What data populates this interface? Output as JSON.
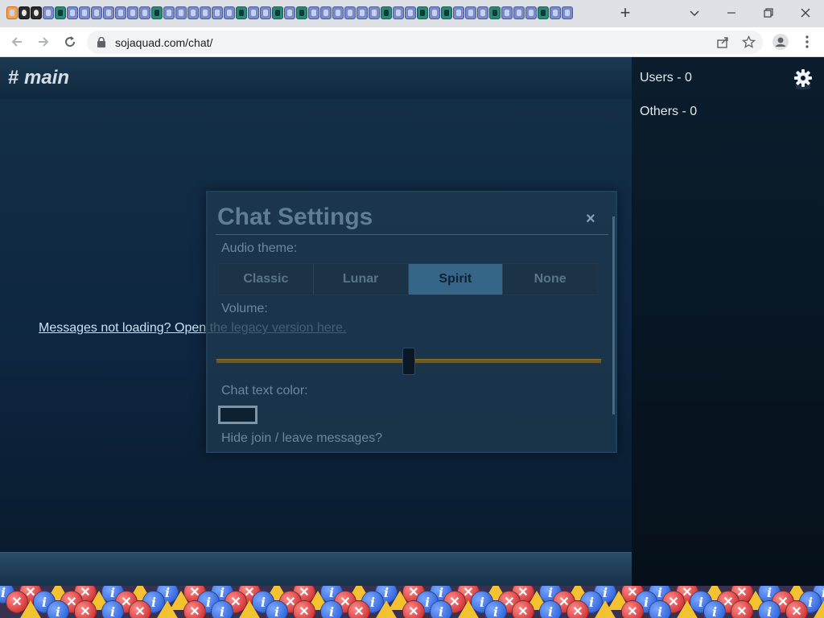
{
  "browser": {
    "url": "sojaquad.com/chat/",
    "new_tab_label": "+"
  },
  "page": {
    "channel_title": "main",
    "channel_hash": "#",
    "legacy_link": "Messages not loading? Open the legacy version here.",
    "sidebar": {
      "users_label": "Users - 0",
      "others_label": "Others - 0"
    }
  },
  "settings_modal": {
    "title": "Chat Settings",
    "close_glyph": "×",
    "audio_theme_label": "Audio theme:",
    "audio_themes": [
      "Classic",
      "Lunar",
      "Spirit",
      "None"
    ],
    "selected_audio_theme": "Spirit",
    "volume_label": "Volume:",
    "volume_level": 0.5,
    "text_color_label": "Chat text color:",
    "hide_join_label": "Hide join / leave messages?"
  },
  "colors": {
    "accent": "#356688",
    "link": "#c9e2f4",
    "volume_track": "#6e5a28"
  },
  "icons": [
    "back-icon",
    "forward-icon",
    "reload-icon",
    "lock-icon",
    "share-icon",
    "star-icon",
    "profile-icon",
    "menu-icon",
    "gear-icon",
    "info-icon",
    "error-icon",
    "warning-icon"
  ]
}
